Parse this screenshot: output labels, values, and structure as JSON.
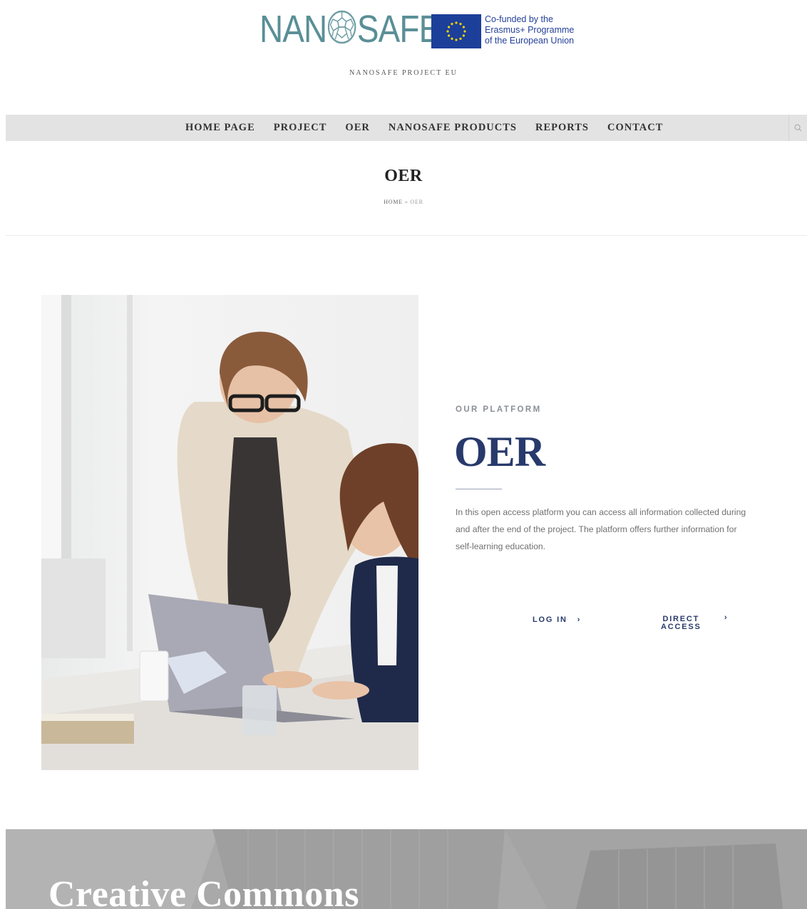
{
  "header": {
    "logo_text_left": "NAN",
    "logo_text_right": "SAFE",
    "eu_lines": [
      "Co-funded by the",
      "Erasmus+ Programme",
      "of the European Union"
    ],
    "tagline": "NANOSAFE PROJECT EU"
  },
  "nav": {
    "items": [
      "HOME PAGE",
      "PROJECT",
      "OER",
      "NANOSAFE PRODUCTS",
      "REPORTS",
      "CONTACT"
    ],
    "search_icon": "search-icon"
  },
  "page": {
    "title": "OER",
    "breadcrumb_home": "HOME",
    "breadcrumb_sep": "»",
    "breadcrumb_current": "OER"
  },
  "platform": {
    "eyebrow": "OUR PLATFORM",
    "title": "OER",
    "description": "In this open access platform you can access all information collected during and after the end of the project. The platform offers further information for self-learning education.",
    "login_label": "LOG IN",
    "direct_line1": "DIRECT",
    "direct_line2": "ACCESS",
    "chevron": "›"
  },
  "banner": {
    "title": "Creative Commons"
  },
  "colors": {
    "brand_teal": "#5a8f96",
    "eu_blue": "#1c3f9a",
    "accent_navy": "#283a6b",
    "nav_bg": "#e3e3e3"
  }
}
